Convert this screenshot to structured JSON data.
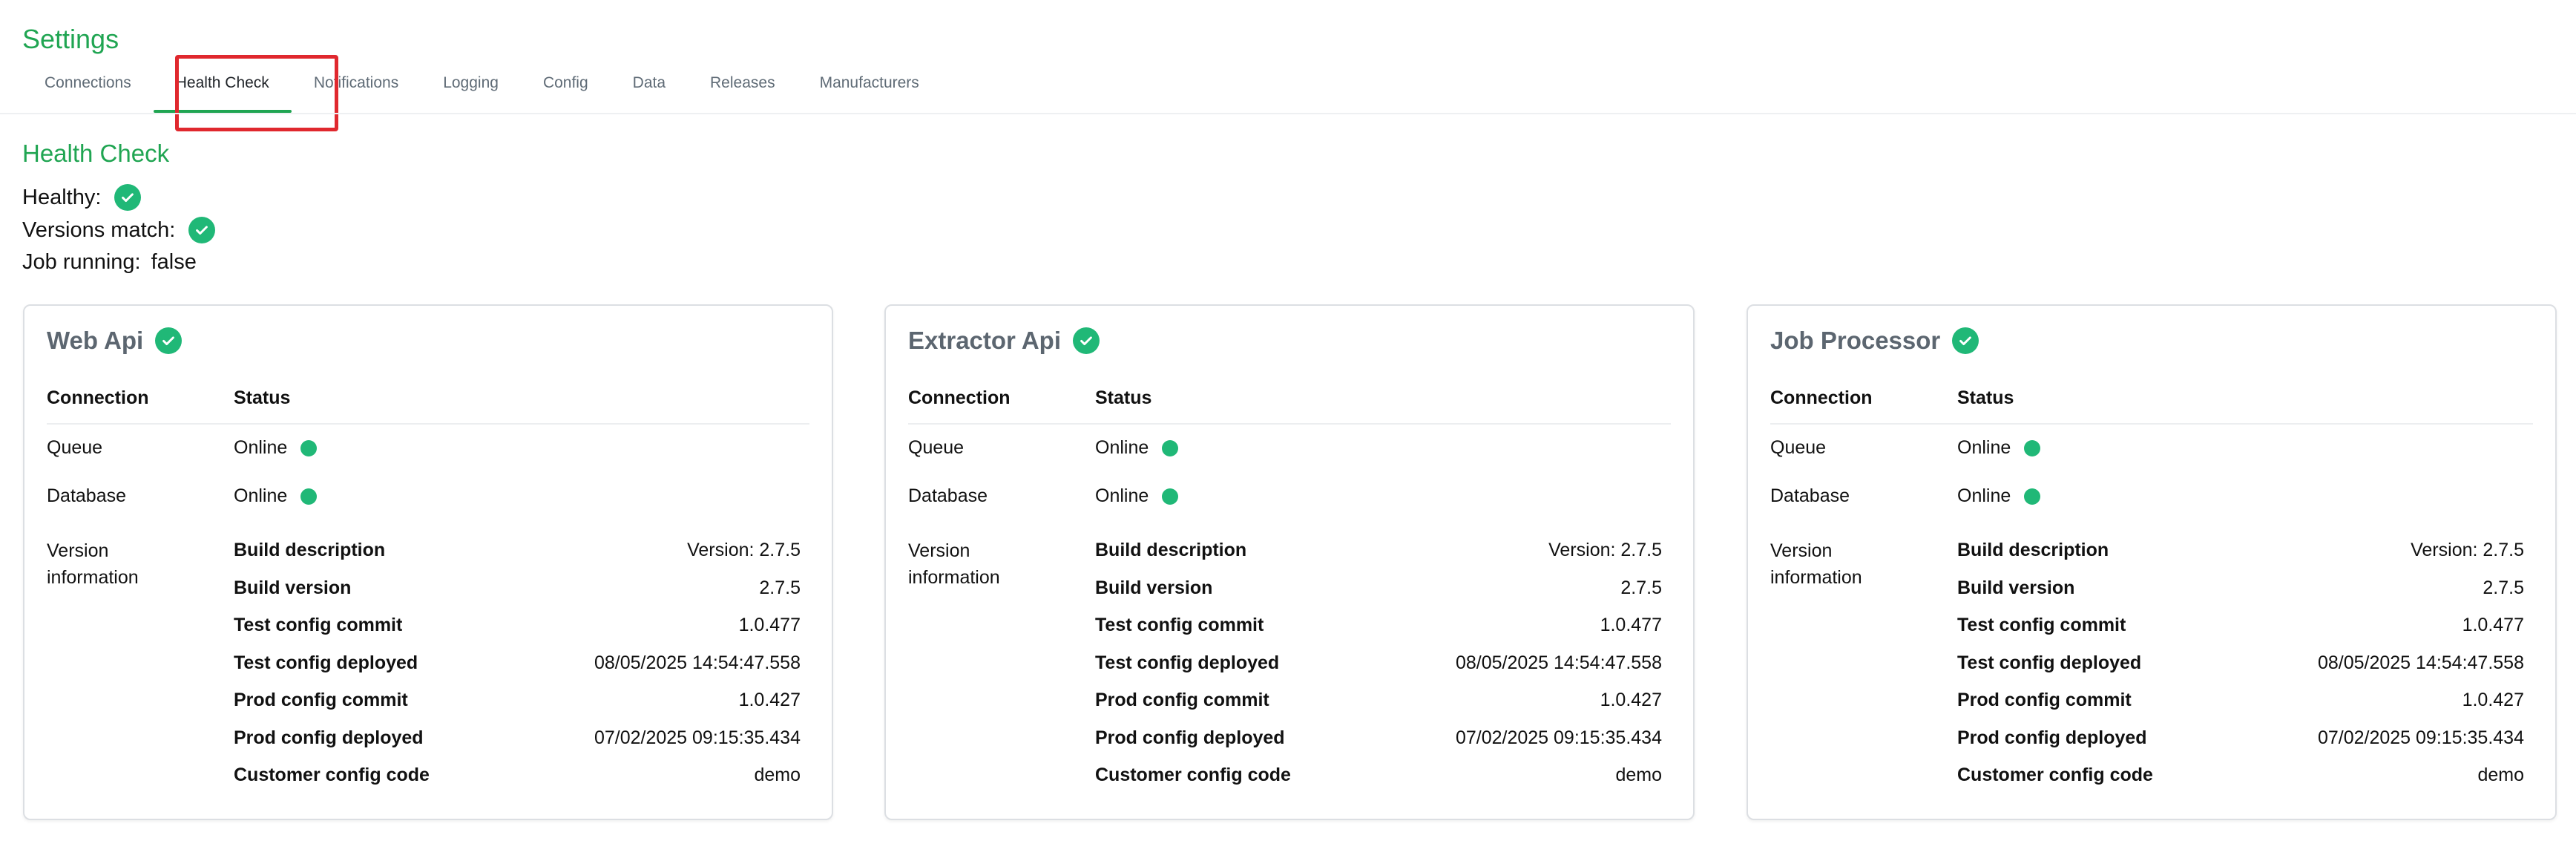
{
  "app": {
    "title": "Settings"
  },
  "tabs": [
    {
      "label": "Connections"
    },
    {
      "label": "Health Check"
    },
    {
      "label": "Notifications"
    },
    {
      "label": "Logging"
    },
    {
      "label": "Config"
    },
    {
      "label": "Data"
    },
    {
      "label": "Releases"
    },
    {
      "label": "Manufacturers"
    }
  ],
  "active_tab": "Health Check",
  "health": {
    "title": "Health Check",
    "healthy_label": "Healthy:",
    "versions_match_label": "Versions match:",
    "job_running_label": "Job running:",
    "job_running_value": "false"
  },
  "icons": {
    "status_ok": "check-circle-icon",
    "online": "green-dot-icon"
  },
  "colors": {
    "accent": "#20a552",
    "ok": "#20b877",
    "highlight": "#e0282e"
  },
  "services": [
    {
      "name": "Web Api",
      "connection_header": "Connection",
      "status_header": "Status",
      "connections": [
        {
          "name": "Queue",
          "status": "Online"
        },
        {
          "name": "Database",
          "status": "Online"
        }
      ],
      "version_label": "Version information",
      "version_rows": [
        {
          "key": "Build description",
          "value": "Version: 2.7.5"
        },
        {
          "key": "Build version",
          "value": "2.7.5"
        },
        {
          "key": "Test config commit",
          "value": "1.0.477"
        },
        {
          "key": "Test config deployed",
          "value": "08/05/2025 14:54:47.558"
        },
        {
          "key": "Prod config commit",
          "value": "1.0.427"
        },
        {
          "key": "Prod config deployed",
          "value": "07/02/2025 09:15:35.434"
        },
        {
          "key": "Customer config code",
          "value": "demo"
        }
      ]
    },
    {
      "name": "Extractor Api",
      "connection_header": "Connection",
      "status_header": "Status",
      "connections": [
        {
          "name": "Queue",
          "status": "Online"
        },
        {
          "name": "Database",
          "status": "Online"
        }
      ],
      "version_label": "Version information",
      "version_rows": [
        {
          "key": "Build description",
          "value": "Version: 2.7.5"
        },
        {
          "key": "Build version",
          "value": "2.7.5"
        },
        {
          "key": "Test config commit",
          "value": "1.0.477"
        },
        {
          "key": "Test config deployed",
          "value": "08/05/2025 14:54:47.558"
        },
        {
          "key": "Prod config commit",
          "value": "1.0.427"
        },
        {
          "key": "Prod config deployed",
          "value": "07/02/2025 09:15:35.434"
        },
        {
          "key": "Customer config code",
          "value": "demo"
        }
      ]
    },
    {
      "name": "Job Processor",
      "connection_header": "Connection",
      "status_header": "Status",
      "connections": [
        {
          "name": "Queue",
          "status": "Online"
        },
        {
          "name": "Database",
          "status": "Online"
        }
      ],
      "version_label": "Version information",
      "version_rows": [
        {
          "key": "Build description",
          "value": "Version: 2.7.5"
        },
        {
          "key": "Build version",
          "value": "2.7.5"
        },
        {
          "key": "Test config commit",
          "value": "1.0.477"
        },
        {
          "key": "Test config deployed",
          "value": "08/05/2025 14:54:47.558"
        },
        {
          "key": "Prod config commit",
          "value": "1.0.427"
        },
        {
          "key": "Prod config deployed",
          "value": "07/02/2025 09:15:35.434"
        },
        {
          "key": "Customer config code",
          "value": "demo"
        }
      ]
    }
  ]
}
